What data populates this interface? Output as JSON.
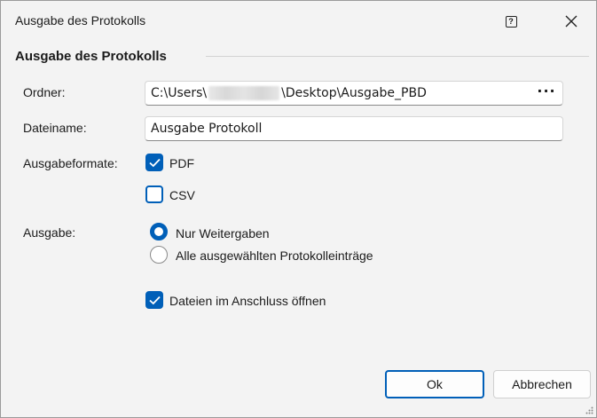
{
  "window": {
    "title": "Ausgabe des Protokolls"
  },
  "section": {
    "title": "Ausgabe des Protokolls"
  },
  "folder": {
    "label": "Ordner:",
    "prefix": "C:\\Users\\",
    "suffix": "\\Desktop\\Ausgabe_PBD",
    "more_label": "···"
  },
  "filename": {
    "label": "Dateiname:",
    "value": "Ausgabe Protokoll"
  },
  "formats": {
    "label": "Ausgabeformate:",
    "pdf": {
      "label": "PDF",
      "checked": true
    },
    "csv": {
      "label": "CSV",
      "checked": false
    }
  },
  "output": {
    "label": "Ausgabe:",
    "options": [
      {
        "label": "Nur Weitergaben",
        "selected": true
      },
      {
        "label": "Alle ausgewählten Protokolleinträge",
        "selected": false
      }
    ]
  },
  "open_after": {
    "label": "Dateien im Anschluss öffnen",
    "checked": true
  },
  "buttons": {
    "ok": "Ok",
    "cancel": "Abbrechen"
  },
  "colors": {
    "accent": "#005fb8",
    "background": "#f3f3f3"
  }
}
